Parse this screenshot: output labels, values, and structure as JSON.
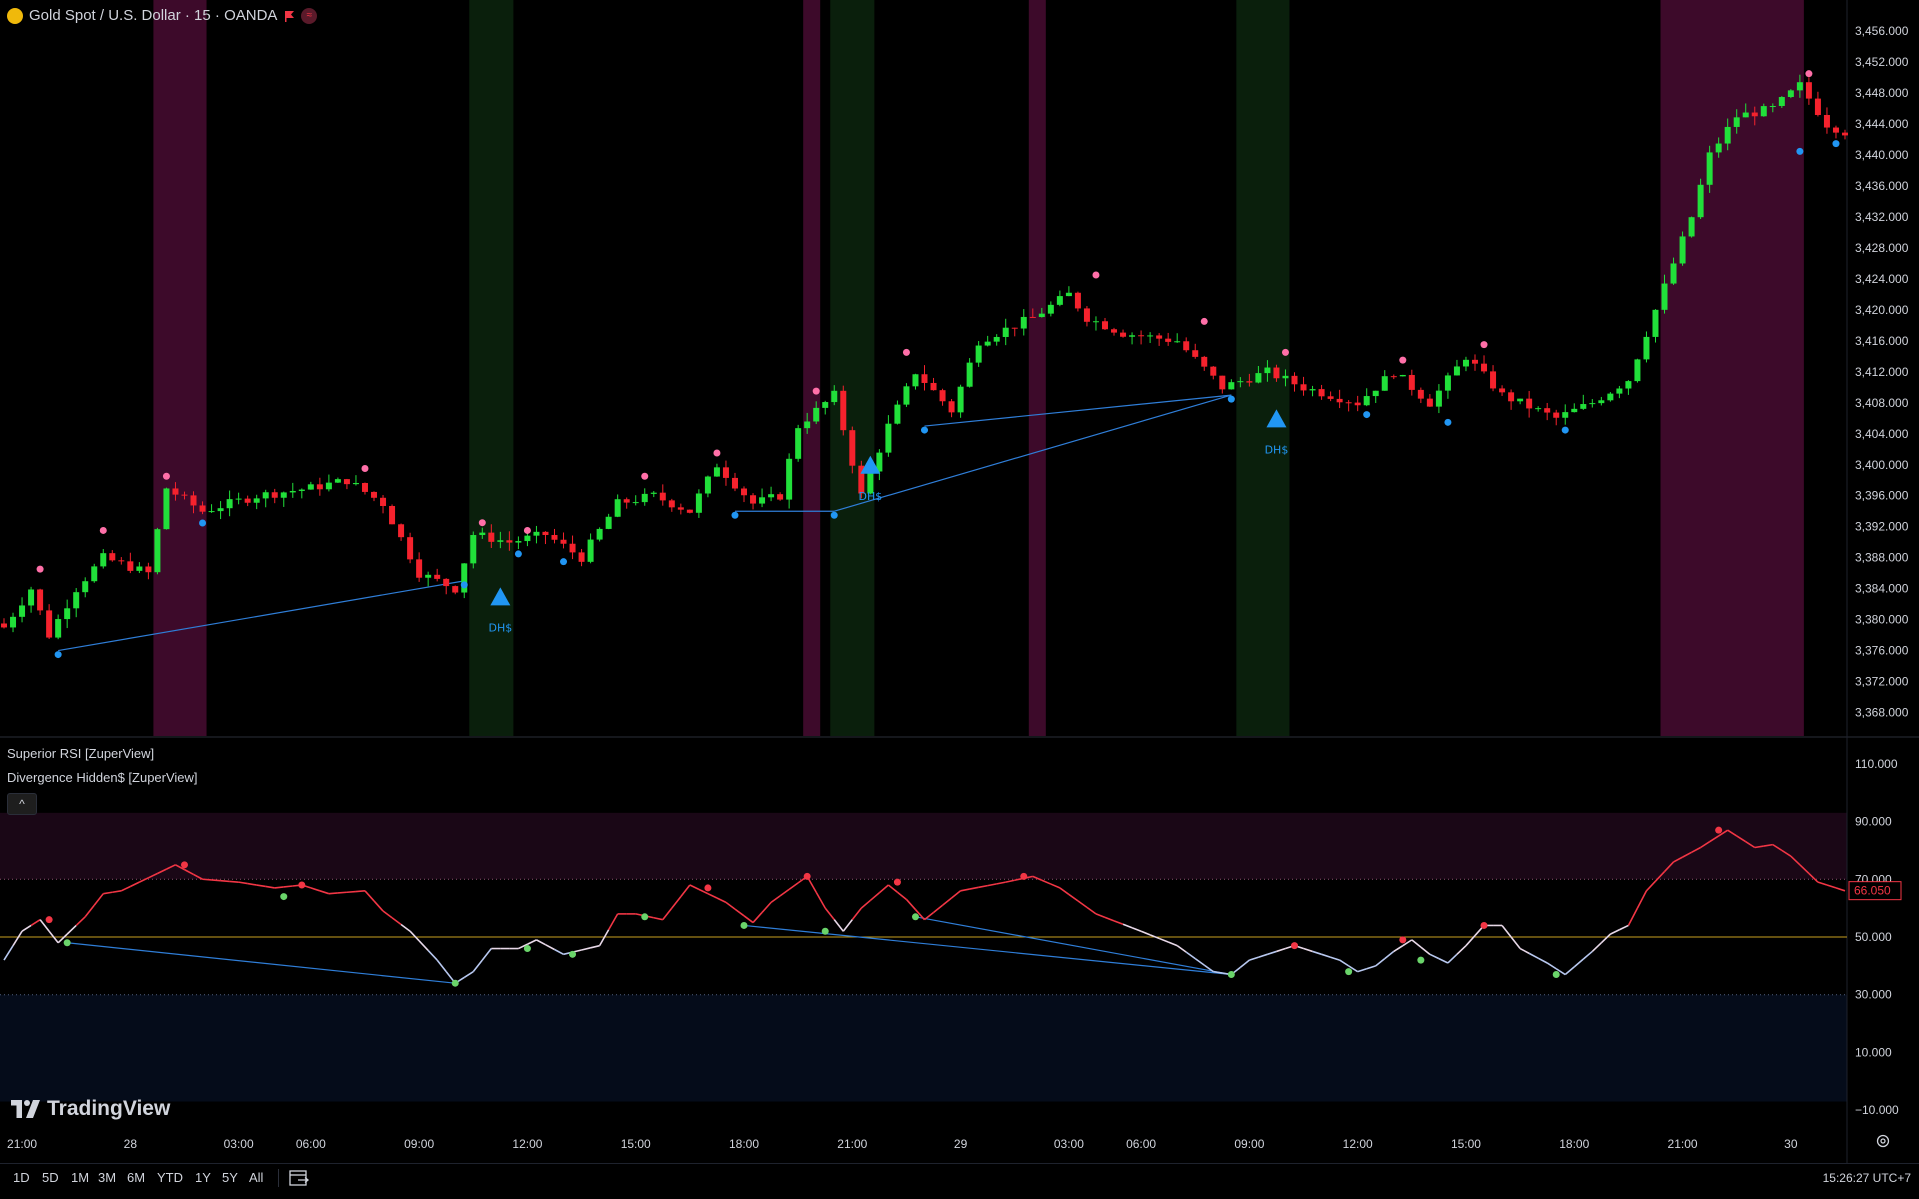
{
  "symbol": {
    "title": "Gold Spot / U.S. Dollar · 15 · OANDA",
    "logo_icon": "gold-coin-icon",
    "flag_icon": "flag-icon",
    "badge_icon": "wave-badge-icon",
    "badge_text": "≈"
  },
  "indicators": [
    "Superior RSI [ZuperView]",
    "Divergence Hidden$ [ZuperView]"
  ],
  "collapse_label": "^",
  "branding": "TradingView",
  "price_axis": {
    "labels": [
      "3,456.000",
      "3,452.000",
      "3,448.000",
      "3,444.000",
      "3,440.000",
      "3,436.000",
      "3,432.000",
      "3,428.000",
      "3,424.000",
      "3,420.000",
      "3,416.000",
      "3,412.000",
      "3,408.000",
      "3,404.000",
      "3,400.000",
      "3,396.000",
      "3,392.000",
      "3,388.000",
      "3,384.000",
      "3,380.000",
      "3,376.000",
      "3,372.000",
      "3,368.000"
    ]
  },
  "rsi_axis": {
    "labels": [
      "110.000",
      "90.000",
      "70.000",
      "50.000",
      "30.000",
      "10.000",
      "−10.000"
    ],
    "current_value": "66.050"
  },
  "time_axis": {
    "labels": [
      "21:00",
      "28",
      "03:00",
      "06:00",
      "09:00",
      "12:00",
      "15:00",
      "18:00",
      "21:00",
      "29",
      "03:00",
      "06:00",
      "09:00",
      "12:00",
      "15:00",
      "18:00",
      "21:00",
      "30"
    ]
  },
  "signal_label": "DH$",
  "toolbar": {
    "ranges": [
      "1D",
      "5D",
      "1M",
      "3M",
      "6M",
      "YTD",
      "1Y",
      "5Y",
      "All"
    ],
    "goto_icon": "calendar-goto-icon",
    "clock": "15:26:27 UTC+7",
    "settings_icon": "gear-icon"
  },
  "colors": {
    "up": "#21e03a",
    "down": "#f5222d",
    "pivot_high": "#ff6fa8",
    "pivot_low": "#2196f3",
    "divergence_line": "#2f7ed8",
    "bear_zone": "#3d0a2a",
    "bull_zone": "#0a1f0c",
    "rsi_high": "#f23645",
    "rsi_low": "#b8c8f0",
    "rsi_mid": "#c8a020"
  },
  "chart_data": [
    {
      "type": "candlestick",
      "title": "Gold Spot / U.S. Dollar · 15 · OANDA",
      "ylim": [
        3366,
        3459
      ],
      "y_ticks": [
        3456,
        3452,
        3448,
        3444,
        3440,
        3436,
        3432,
        3428,
        3424,
        3420,
        3416,
        3412,
        3408,
        3404,
        3400,
        3396,
        3392,
        3388,
        3384,
        3380,
        3376,
        3372,
        3368
      ],
      "x_start": "27 20:30",
      "x_step_minutes": 15,
      "time_ticks": [
        {
          "label": "21:00",
          "i": 2
        },
        {
          "label": "28",
          "i": 14
        },
        {
          "label": "03:00",
          "i": 26
        },
        {
          "label": "06:00",
          "i": 34
        },
        {
          "label": "09:00",
          "i": 46
        },
        {
          "label": "12:00",
          "i": 58
        },
        {
          "label": "15:00",
          "i": 70
        },
        {
          "label": "18:00",
          "i": 82
        },
        {
          "label": "21:00",
          "i": 94
        },
        {
          "label": "29",
          "i": 106
        },
        {
          "label": "03:00",
          "i": 118
        },
        {
          "label": "06:00",
          "i": 126
        },
        {
          "label": "09:00",
          "i": 138
        },
        {
          "label": "12:00",
          "i": 150
        },
        {
          "label": "15:00",
          "i": 162
        },
        {
          "label": "18:00",
          "i": 174
        },
        {
          "label": "21:00",
          "i": 186
        },
        {
          "label": "30",
          "i": 198
        }
      ],
      "key_closes": [
        [
          0,
          3379
        ],
        [
          3,
          3384
        ],
        [
          5,
          3378
        ],
        [
          8,
          3384
        ],
        [
          11,
          3388
        ],
        [
          16,
          3386
        ],
        [
          18,
          3397
        ],
        [
          22,
          3394
        ],
        [
          28,
          3396
        ],
        [
          34,
          3397
        ],
        [
          38,
          3398
        ],
        [
          42,
          3395
        ],
        [
          46,
          3386
        ],
        [
          50,
          3384
        ],
        [
          52,
          3391
        ],
        [
          56,
          3390
        ],
        [
          60,
          3391
        ],
        [
          64,
          3388
        ],
        [
          68,
          3395
        ],
        [
          72,
          3396
        ],
        [
          76,
          3394
        ],
        [
          79,
          3400
        ],
        [
          83,
          3395
        ],
        [
          86,
          3396
        ],
        [
          88,
          3405
        ],
        [
          92,
          3409
        ],
        [
          95,
          3396
        ],
        [
          98,
          3405
        ],
        [
          101,
          3412
        ],
        [
          105,
          3407
        ],
        [
          108,
          3416
        ],
        [
          114,
          3419
        ],
        [
          118,
          3422
        ],
        [
          120,
          3419
        ],
        [
          124,
          3417
        ],
        [
          130,
          3416
        ],
        [
          135,
          3410
        ],
        [
          140,
          3412
        ],
        [
          144,
          3410
        ],
        [
          150,
          3408
        ],
        [
          154,
          3412
        ],
        [
          158,
          3408
        ],
        [
          162,
          3414
        ],
        [
          166,
          3409
        ],
        [
          172,
          3406
        ],
        [
          176,
          3408
        ],
        [
          180,
          3411
        ],
        [
          184,
          3423
        ],
        [
          187,
          3432
        ],
        [
          189,
          3440
        ],
        [
          192,
          3445
        ],
        [
          196,
          3446
        ],
        [
          199,
          3449
        ],
        [
          202,
          3444
        ],
        [
          204,
          3443
        ]
      ],
      "pivot_highs": [
        [
          4,
          3386
        ],
        [
          11,
          3391
        ],
        [
          18,
          3398
        ],
        [
          40,
          3399
        ],
        [
          53,
          3392
        ],
        [
          58,
          3391
        ],
        [
          71,
          3398
        ],
        [
          79,
          3401
        ],
        [
          90,
          3409
        ],
        [
          100,
          3414
        ],
        [
          121,
          3424
        ],
        [
          133,
          3418
        ],
        [
          142,
          3414
        ],
        [
          155,
          3413
        ],
        [
          164,
          3415
        ],
        [
          200,
          3450
        ]
      ],
      "pivot_lows": [
        [
          6,
          3376
        ],
        [
          22,
          3393
        ],
        [
          51,
          3385
        ],
        [
          57,
          3389
        ],
        [
          62,
          3388
        ],
        [
          81,
          3394
        ],
        [
          92,
          3394
        ],
        [
          102,
          3405
        ],
        [
          136,
          3409
        ],
        [
          151,
          3407
        ],
        [
          160,
          3406
        ],
        [
          173,
          3405
        ],
        [
          199,
          3441
        ],
        [
          203,
          3442
        ]
      ],
      "divergence_lines": [
        [
          [
            6,
            3376
          ],
          [
            51,
            3385
          ]
        ],
        [
          [
            81,
            3394
          ],
          [
            92,
            3394
          ]
        ],
        [
          [
            92,
            3394
          ],
          [
            136,
            3409
          ]
        ],
        [
          [
            102,
            3405
          ],
          [
            136,
            3409
          ]
        ]
      ],
      "signals": [
        {
          "i": 55,
          "price": 3383,
          "label": "DH$"
        },
        {
          "i": 96,
          "price": 3400,
          "label": "DH$"
        },
        {
          "i": 141,
          "price": 3406,
          "label": "DH$"
        }
      ],
      "bear_zones": [
        [
          17,
          22
        ],
        [
          89,
          90
        ],
        [
          114,
          115
        ],
        [
          184,
          199
        ]
      ],
      "bull_zones": [
        [
          52,
          56
        ],
        [
          92,
          96
        ],
        [
          137,
          142
        ]
      ]
    },
    {
      "type": "line",
      "title": "Superior RSI [ZuperView]",
      "ylim": [
        -12,
        112
      ],
      "y_ticks": [
        110,
        90,
        70,
        50,
        30,
        10,
        -10
      ],
      "levels": {
        "overbought": 70,
        "mid": 50,
        "oversold": 30
      },
      "last_value": 66.05,
      "key_points": [
        [
          0,
          42
        ],
        [
          2,
          52
        ],
        [
          4,
          56
        ],
        [
          6,
          48
        ],
        [
          9,
          57
        ],
        [
          11,
          65
        ],
        [
          13,
          66
        ],
        [
          17,
          72
        ],
        [
          19,
          75
        ],
        [
          22,
          70
        ],
        [
          26,
          69
        ],
        [
          30,
          67
        ],
        [
          33,
          68
        ],
        [
          36,
          65
        ],
        [
          40,
          66
        ],
        [
          42,
          59
        ],
        [
          45,
          52
        ],
        [
          48,
          42
        ],
        [
          50,
          34
        ],
        [
          52,
          38
        ],
        [
          54,
          46
        ],
        [
          57,
          46
        ],
        [
          59,
          49
        ],
        [
          62,
          44
        ],
        [
          66,
          47
        ],
        [
          68,
          58
        ],
        [
          70,
          58
        ],
        [
          73,
          56
        ],
        [
          76,
          68
        ],
        [
          78,
          65
        ],
        [
          80,
          62
        ],
        [
          83,
          55
        ],
        [
          85,
          62
        ],
        [
          89,
          71
        ],
        [
          91,
          60
        ],
        [
          93,
          52
        ],
        [
          95,
          60
        ],
        [
          98,
          68
        ],
        [
          100,
          63
        ],
        [
          102,
          56
        ],
        [
          106,
          66
        ],
        [
          111,
          69
        ],
        [
          114,
          71
        ],
        [
          117,
          67
        ],
        [
          121,
          58
        ],
        [
          126,
          52
        ],
        [
          130,
          47
        ],
        [
          134,
          38
        ],
        [
          136,
          37
        ],
        [
          138,
          42
        ],
        [
          141,
          45
        ],
        [
          143,
          47
        ],
        [
          146,
          44
        ],
        [
          148,
          42
        ],
        [
          150,
          38
        ],
        [
          152,
          40
        ],
        [
          154,
          45
        ],
        [
          156,
          49
        ],
        [
          158,
          44
        ],
        [
          160,
          41
        ],
        [
          162,
          47
        ],
        [
          164,
          54
        ],
        [
          166,
          54
        ],
        [
          168,
          46
        ],
        [
          171,
          41
        ],
        [
          173,
          37
        ],
        [
          176,
          45
        ],
        [
          178,
          51
        ],
        [
          180,
          54
        ],
        [
          182,
          66
        ],
        [
          185,
          76
        ],
        [
          188,
          81
        ],
        [
          191,
          87
        ],
        [
          194,
          81
        ],
        [
          196,
          82
        ],
        [
          198,
          78
        ],
        [
          201,
          69
        ],
        [
          204,
          66
        ]
      ],
      "pivot_highs": [
        [
          5,
          56
        ],
        [
          20,
          75
        ],
        [
          33,
          68
        ],
        [
          78,
          67
        ],
        [
          89,
          71
        ],
        [
          99,
          69
        ],
        [
          113,
          71
        ],
        [
          143,
          47
        ],
        [
          155,
          49
        ],
        [
          164,
          54
        ],
        [
          190,
          87
        ]
      ],
      "pivot_lows": [
        [
          7,
          48
        ],
        [
          50,
          34
        ],
        [
          31,
          64
        ],
        [
          58,
          46
        ],
        [
          63,
          44
        ],
        [
          71,
          57
        ],
        [
          82,
          54
        ],
        [
          91,
          52
        ],
        [
          101,
          57
        ],
        [
          136,
          37
        ],
        [
          149,
          38
        ],
        [
          157,
          42
        ],
        [
          172,
          37
        ]
      ],
      "divergence_lines": [
        [
          [
            7,
            48
          ],
          [
            50,
            34
          ]
        ],
        [
          [
            82,
            54
          ],
          [
            136,
            37
          ]
        ],
        [
          [
            101,
            57
          ],
          [
            136,
            37
          ]
        ]
      ]
    }
  ]
}
